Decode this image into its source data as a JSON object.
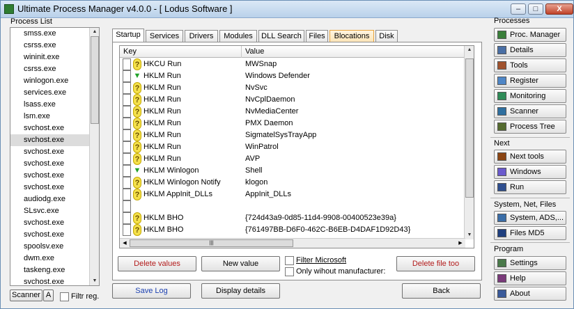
{
  "window": {
    "title": "Ultimate Process Manager v4.0.0 - [ Lodus Software ]",
    "controls": {
      "minimize": "–",
      "maximize": "□",
      "close": "X"
    }
  },
  "process_list": {
    "label": "Process List",
    "items": [
      "smss.exe",
      "csrss.exe",
      "wininit.exe",
      "csrss.exe",
      "winlogon.exe",
      "services.exe",
      "lsass.exe",
      "lsm.exe",
      "svchost.exe",
      "svchost.exe",
      "svchost.exe",
      "svchost.exe",
      "svchost.exe",
      "svchost.exe",
      "audiodg.exe",
      "SLsvc.exe",
      "svchost.exe",
      "svchost.exe",
      "spoolsv.exe",
      "dwm.exe",
      "taskeng.exe",
      "svchost.exe"
    ],
    "selected_index": 9,
    "scanner_tab": "Scanner",
    "scanner_sub": "A",
    "filter_label": "Filtr reg."
  },
  "tabs": [
    "Startup",
    "Services",
    "Drivers",
    "Modules",
    "DLL Search",
    "Files",
    "Blocations",
    "Disk"
  ],
  "active_tab": "Startup",
  "highlighted_tab": "Blocations",
  "grid": {
    "headers": {
      "key": "Key",
      "value": "Value"
    },
    "rows": [
      {
        "icon": "question-icon",
        "key": "HKCU Run",
        "value": "MWSnap"
      },
      {
        "icon": "check-icon",
        "key": "HKLM Run",
        "value": "Windows Defender"
      },
      {
        "icon": "question-icon",
        "key": "HKLM Run",
        "value": "NvSvc"
      },
      {
        "icon": "question-icon",
        "key": "HKLM Run",
        "value": "NvCplDaemon"
      },
      {
        "icon": "question-icon",
        "key": "HKLM Run",
        "value": "NvMediaCenter"
      },
      {
        "icon": "question-icon",
        "key": "HKLM Run",
        "value": "PMX Daemon"
      },
      {
        "icon": "question-icon",
        "key": "HKLM Run",
        "value": "SigmatelSysTrayApp"
      },
      {
        "icon": "question-icon",
        "key": "HKLM Run",
        "value": "WinPatrol"
      },
      {
        "icon": "question-icon",
        "key": "HKLM Run",
        "value": "AVP"
      },
      {
        "icon": "check-icon",
        "key": "HKLM Winlogon",
        "value": "Shell"
      },
      {
        "icon": "question-icon",
        "key": "HKLM Winlogon Notify",
        "value": "klogon"
      },
      {
        "icon": "question-icon",
        "key": "HKLM AppInit_DLLs",
        "value": "AppInit_DLLs"
      },
      {
        "icon": "none",
        "key": "",
        "value": ""
      },
      {
        "icon": "question-icon",
        "key": "HKLM BHO",
        "value": "{724d43a9-0d85-11d4-9908-00400523e39a}"
      },
      {
        "icon": "question-icon",
        "key": "HKLM BHO",
        "value": "{761497BB-D6F0-462C-B6EB-D4DAF1D92D43}"
      }
    ]
  },
  "actions": {
    "delete_values": "Delete values",
    "new_value": "New value",
    "filter_microsoft": "Filter Microsoft",
    "only_without_manufacturer": "Only wihout manufacturer:",
    "delete_file_too": "Delete file too",
    "save_log": "Save Log",
    "display_details": "Display details",
    "back": "Back"
  },
  "sidebar": {
    "processes_label": "Processes",
    "processes": [
      {
        "label": "Proc. Manager",
        "icon": "process-manager-icon",
        "color": "#3a7f3a"
      },
      {
        "label": "Details",
        "icon": "details-icon",
        "color": "#4a6fa5"
      },
      {
        "label": "Tools",
        "icon": "tools-icon",
        "color": "#a0522d"
      },
      {
        "label": "Register",
        "icon": "register-icon",
        "color": "#4f86c6"
      },
      {
        "label": "Monitoring",
        "icon": "monitoring-icon",
        "color": "#2e8b57"
      },
      {
        "label": "Scanner",
        "icon": "scanner-icon",
        "color": "#2f6f9f"
      },
      {
        "label": "Process Tree",
        "icon": "process-tree-icon",
        "color": "#556b2f"
      }
    ],
    "next_label": "Next",
    "next": [
      {
        "label": "Next tools",
        "icon": "next-tools-icon",
        "color": "#8b4513"
      },
      {
        "label": "Windows",
        "icon": "windows-icon",
        "color": "#6a5acd"
      },
      {
        "label": "Run",
        "icon": "run-icon",
        "color": "#2f4f8f"
      }
    ],
    "system_label": "System, Net, Files",
    "system": [
      {
        "label": "System, ADS,...",
        "icon": "system-icon",
        "color": "#3b6ea8"
      },
      {
        "label": "Files MD5",
        "icon": "files-md5-icon",
        "color": "#1f3f7f"
      }
    ],
    "program_label": "Program",
    "program": [
      {
        "label": "Settings",
        "icon": "settings-icon",
        "color": "#4a7a4a"
      },
      {
        "label": "Help",
        "icon": "help-icon",
        "color": "#7a3a7a"
      },
      {
        "label": "About",
        "icon": "about-icon",
        "color": "#3a5a9a"
      }
    ]
  }
}
